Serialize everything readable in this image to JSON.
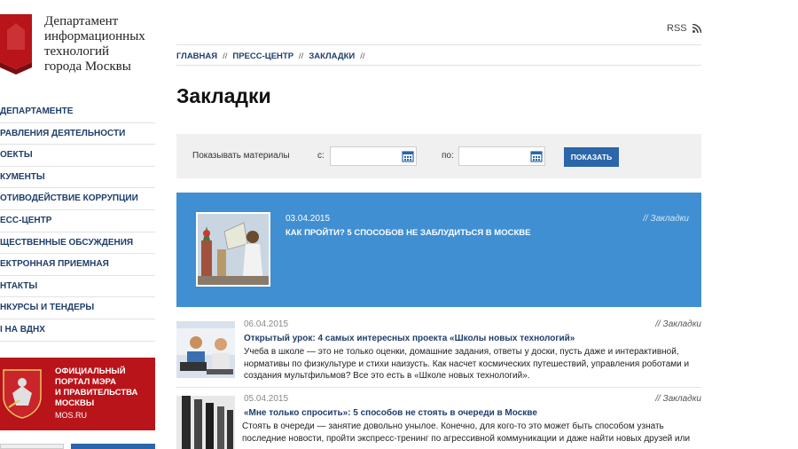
{
  "logo": {
    "text": "Департамент\nинформационных\nтехнологий\nгорода Москвы"
  },
  "nav": {
    "items": [
      "ДЕПАРТАМЕНТЕ",
      "РАВЛЕНИЯ ДЕЯТЕЛЬНОСТИ",
      "ОЕКТЫ",
      "КУМЕНТЫ",
      "ОТИВОДЕЙСТВИЕ КОРРУПЦИИ",
      "ЕСС-ЦЕНТР",
      "ЩЕСТВЕННЫЕ ОБСУЖДЕНИЯ",
      "ЕКТРОННАЯ ПРИЕМНАЯ",
      "НТАКТЫ",
      "НКУРСЫ И ТЕНДЕРЫ",
      "I НА ВДНХ"
    ]
  },
  "mos_banner": {
    "text": "ОФИЦИАЛЬНЫЙ\nПОРТАЛ МЭРА\nИ ПРАВИТЕЛЬСТВА\nМОСКВЫ",
    "url": "MOS.RU"
  },
  "header": {
    "rss": "RSS"
  },
  "breadcrumb": {
    "items": [
      "ГЛАВНАЯ",
      "ПРЕСС-ЦЕНТР",
      "ЗАКЛАДКИ"
    ],
    "separator": "//"
  },
  "page": {
    "title": "Закладки"
  },
  "filter": {
    "label": "Показывать материалы",
    "from_label": "с:",
    "to_label": "по:",
    "from_value": "",
    "to_value": "",
    "button": "ПОКАЗАТЬ"
  },
  "featured": {
    "date": "03.04.2015",
    "title": "КАК ПРОЙТИ? 5 СПОСОБОВ НЕ ЗАБЛУДИТЬСЯ В МОСКВЕ",
    "tag": "// Закладки"
  },
  "news": [
    {
      "date": "06.04.2015",
      "tag": "// Закладки",
      "title": "Открытый урок: 4 самых интересных проекта «Школы новых технологий»",
      "text": "Учеба в школе — это не только оценки, домашние задания, ответы у доски, пусть даже и интерактивной, нормативы по физкультуре и стихи наизусть. Как насчет космических путешествий, управления роботами и создания мультфильмов? Все это есть в «Школе новых технологий»."
    },
    {
      "date": "05.04.2015",
      "tag": "// Закладки",
      "title": "«Мне только спросить»: 5 способов не стоять в очереди в Москве",
      "text": "Стоять в очереди — занятие довольно унылое. Конечно, для кого-то это может быть способом узнать последние новости, пройти экспресс-тренинг по агрессивной коммуникации и даже найти новых друзей или"
    }
  ],
  "colors": {
    "accent_blue": "#3f8fd2",
    "button_blue": "#2a66a9",
    "nav_text": "#1f3e6b",
    "mos_red": "#b8141a"
  }
}
